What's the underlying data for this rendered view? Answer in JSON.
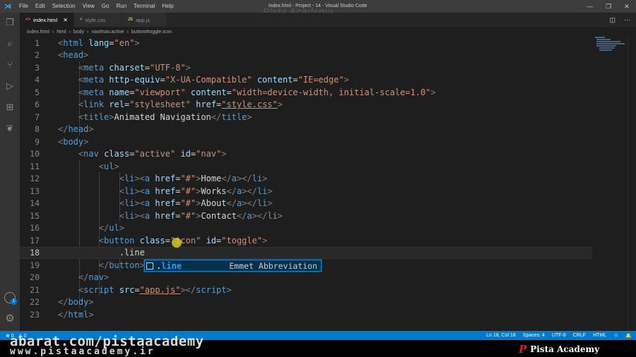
{
  "window": {
    "title": "index.html - Project - 14 - Visual Studio Code",
    "menu": [
      "File",
      "Edit",
      "Selection",
      "View",
      "Go",
      "Run",
      "Terminal",
      "Help"
    ],
    "controls": [
      "—",
      "❐",
      "✕"
    ]
  },
  "tabs": [
    {
      "label": "index.html",
      "type_icon": "<>",
      "active": true
    },
    {
      "label": "style.css",
      "type_icon": "#",
      "active": false
    },
    {
      "label": "app.js",
      "type_icon": "JS",
      "active": false
    }
  ],
  "breadcrumb": [
    "index.html",
    "html",
    "body",
    "nav#nav.active",
    "button#toggle.icon"
  ],
  "editor": {
    "lines": [
      "1",
      "2",
      "3",
      "4",
      "5",
      "6",
      "7",
      "8",
      "9",
      "10",
      "11",
      "12",
      "13",
      "14",
      "15",
      "16",
      "17",
      "18",
      "19",
      "20",
      "21",
      "22",
      "23"
    ]
  },
  "suggest": {
    "label_prefix": ".",
    "label_match": "line",
    "detail": "Emmet Abbreviation"
  },
  "accounts_badge": "1",
  "status": {
    "errors": "⊗ 0",
    "warnings": "⚠ 0",
    "position": "Ln 18, Col 18",
    "spaces": "Spaces: 4",
    "encoding": "UTF-8",
    "eol": "CRLF",
    "language": "HTML",
    "feedback": "☺",
    "bell": "🔔"
  },
  "watermarks": {
    "url": "abarat.com/pistaacademy",
    "site": "www.pistaacademy.ir",
    "brand_letter": "P",
    "brand": "Pista Academy",
    "top": "Pista Academy"
  },
  "colors": {
    "tag": "#569cd6",
    "attribute": "#9cdcfe",
    "string": "#ce9178",
    "statusbar": "#007acc"
  }
}
